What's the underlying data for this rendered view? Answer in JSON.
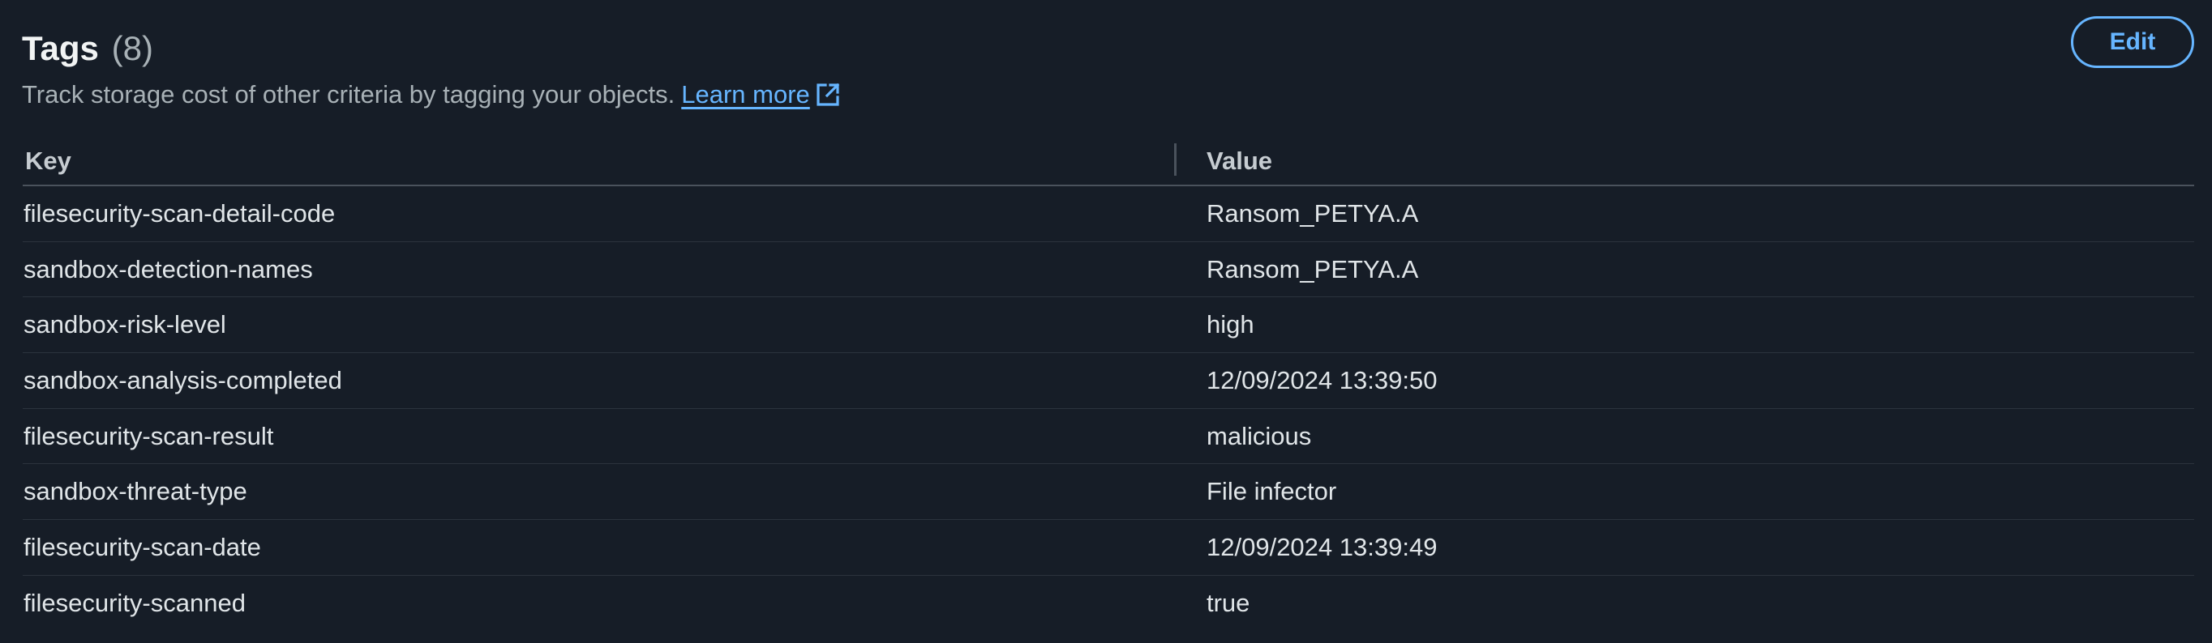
{
  "header": {
    "title": "Tags",
    "count": "(8)",
    "description": "Track storage cost of other criteria by tagging your objects.",
    "learn_more": "Learn more",
    "edit_label": "Edit"
  },
  "table": {
    "columns": [
      "Key",
      "Value"
    ],
    "rows": [
      {
        "key": "filesecurity-scan-detail-code",
        "value": "Ransom_PETYA.A"
      },
      {
        "key": "sandbox-detection-names",
        "value": "Ransom_PETYA.A"
      },
      {
        "key": "sandbox-risk-level",
        "value": "high"
      },
      {
        "key": "sandbox-analysis-completed",
        "value": "12/09/2024 13:39:50"
      },
      {
        "key": "filesecurity-scan-result",
        "value": "malicious"
      },
      {
        "key": "sandbox-threat-type",
        "value": "File infector"
      },
      {
        "key": "filesecurity-scan-date",
        "value": "12/09/2024 13:39:49"
      },
      {
        "key": "filesecurity-scanned",
        "value": "true"
      }
    ]
  },
  "colors": {
    "background": "#161d27",
    "accent": "#66b5ff",
    "text": "#e0e5e8",
    "muted": "#a8b1b6"
  },
  "icons": {
    "learn_more": "external-link-icon"
  }
}
